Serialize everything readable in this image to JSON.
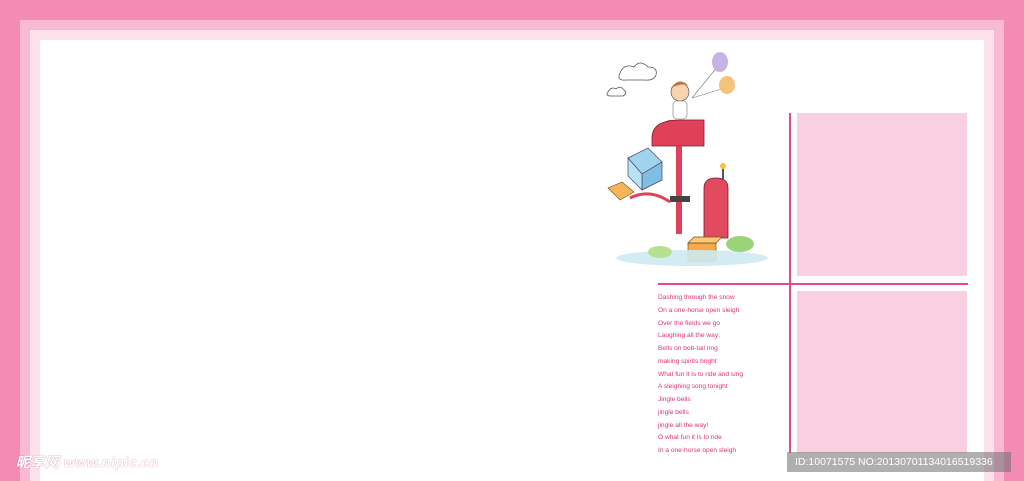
{
  "lyrics": [
    "Dashing through the snow",
    "On a one-horse open sleigh",
    "Over the fields we go",
    "Laughing all the way;",
    "Bells on bob-tail ring",
    "making spirits bright",
    "What fun it is to ride and sing",
    "A sleighing song tonight",
    "Jingle bells",
    "jingle bells",
    "jingle all the way!",
    "O what fun it is to ride",
    "In a one-horse open sleigh"
  ],
  "watermark": {
    "site": "昵享网 www.nipic.cn",
    "id": "ID:10071575 NO:20130701134016519336"
  },
  "colors": {
    "outer_frame": "#f48bb4",
    "accent_rule": "#e8478e",
    "photo_box": "#f9cfe2",
    "lyrics_text": "#e0307a"
  }
}
